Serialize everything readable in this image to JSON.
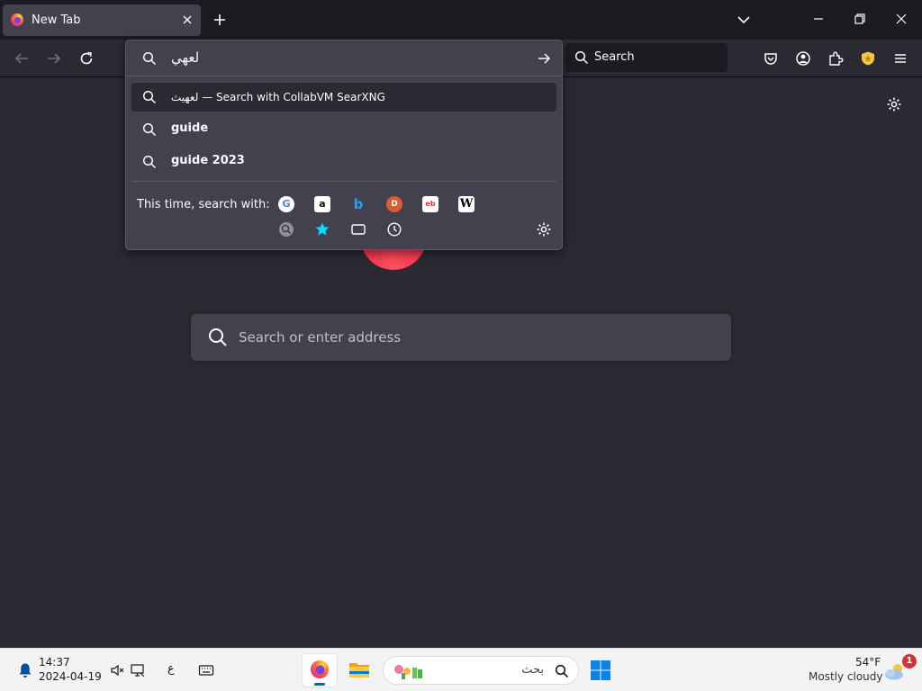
{
  "browser": {
    "tab_title": "New Tab",
    "toolbar_search_placeholder": "Search"
  },
  "urlbar": {
    "typed_text": "لعهي",
    "results": [
      {
        "query": "لعهيث",
        "separator": "—",
        "action": "Search with CollabVM SearXNG"
      },
      {
        "query": "guide"
      },
      {
        "query": "guide 2023"
      }
    ],
    "oneoff_label": "This time, search with:",
    "engines": [
      "google-icon",
      "amazon-icon",
      "bing-icon",
      "duckduckgo-icon",
      "ebay-icon",
      "wikipedia-icon",
      "searxng-icon",
      "bookmarks-icon",
      "tabs-icon",
      "history-icon"
    ]
  },
  "newtab": {
    "search_placeholder": "Search or enter address"
  },
  "taskbar": {
    "time": "14:37",
    "date": "2024-04-19",
    "lang": "ع",
    "search_text": "بحث",
    "weather_temp": "54°F",
    "weather_desc": "Mostly cloudy",
    "notification_count": "1"
  },
  "colors": {
    "background": "#2b2a33",
    "tabbar": "#1c1b22",
    "panel": "#42414d",
    "accent": "#0067c0"
  }
}
